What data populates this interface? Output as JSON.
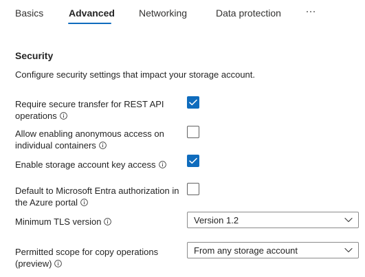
{
  "tabs": [
    {
      "label": "Basics"
    },
    {
      "label": "Advanced"
    },
    {
      "label": "Networking"
    },
    {
      "label": "Data protection"
    }
  ],
  "tabs_more": "···",
  "active_tab": "Advanced",
  "section": {
    "title": "Security",
    "description": "Configure security settings that impact your storage account."
  },
  "fields": {
    "secure_transfer": {
      "label": "Require secure transfer for REST API operations",
      "checked": true
    },
    "anonymous_access": {
      "label": "Allow enabling anonymous access on individual containers",
      "checked": false
    },
    "key_access": {
      "label": "Enable storage account key access",
      "checked": true
    },
    "entra_default": {
      "label": "Default to Microsoft Entra authorization in the Azure portal",
      "checked": false
    },
    "tls_version": {
      "label": "Minimum TLS version",
      "value": "Version 1.2"
    },
    "copy_scope": {
      "label": "Permitted scope for copy operations (preview)",
      "value": "From any storage account"
    }
  },
  "colors": {
    "accent": "#0f6cbd",
    "text": "#242424",
    "border": "#8a8a8a"
  },
  "icons": {
    "info": "info-icon",
    "check": "checkmark-icon",
    "chevron": "chevron-down-icon",
    "more": "more-horizontal-icon"
  }
}
